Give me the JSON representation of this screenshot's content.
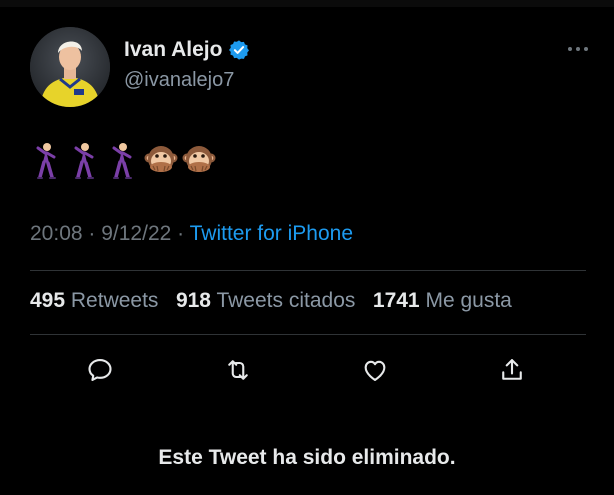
{
  "tweet": {
    "author": {
      "display_name": "Ivan Alejo",
      "handle": "@ivanalejo7",
      "verified": true,
      "avatar_icon": "player-avatar"
    },
    "emojis": [
      "dancing-figure",
      "dancing-figure",
      "dancing-figure",
      "speak-no-evil-monkey",
      "speak-no-evil-monkey"
    ],
    "time": "20:08",
    "date": "9/12/22",
    "source": "Twitter for iPhone",
    "stats": {
      "retweets": "495",
      "retweets_label": "Retweets",
      "quotes": "918",
      "quotes_label": "Tweets citados",
      "likes": "1741",
      "likes_label": "Me gusta"
    },
    "actions": [
      "reply-icon",
      "retweet-icon",
      "like-icon",
      "share-icon"
    ],
    "deleted_notice": "Este Tweet ha sido eliminado."
  },
  "colors": {
    "background": "#000000",
    "text": "#e7e9ea",
    "muted": "#6e767d",
    "link": "#1d9bf0",
    "divider": "#2f3336"
  }
}
